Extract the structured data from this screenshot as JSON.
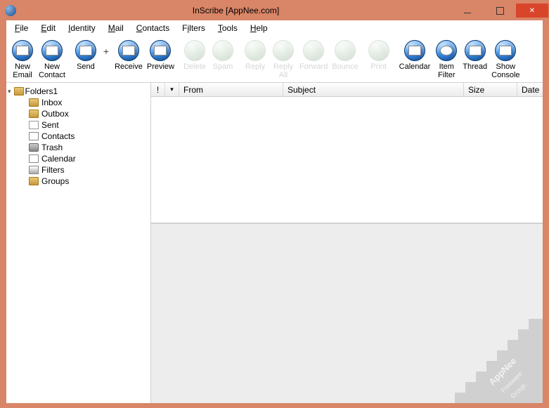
{
  "window": {
    "title": "InScribe [AppNee.com]"
  },
  "menu": {
    "file": "File",
    "edit": "Edit",
    "identity": "Identity",
    "mail": "Mail",
    "contacts": "Contacts",
    "filters": "Filters",
    "tools": "Tools",
    "help": "Help"
  },
  "toolbar": {
    "new_email": "New\nEmail",
    "new_contact": "New\nContact",
    "send": "Send",
    "plus": "+",
    "receive": "Receive",
    "preview": "Preview",
    "delete": "Delete",
    "spam": "Spam",
    "reply": "Reply",
    "reply_all": "Reply\nAll",
    "forward": "Forward",
    "bounce": "Bounce",
    "print": "Print",
    "calendar": "Calendar",
    "item_filter": "Item\nFilter",
    "thread": "Thread",
    "show_console": "Show\nConsole"
  },
  "sidebar": {
    "root": "Folders1",
    "items": [
      {
        "label": "Inbox"
      },
      {
        "label": "Outbox"
      },
      {
        "label": "Sent"
      },
      {
        "label": "Contacts"
      },
      {
        "label": "Trash"
      },
      {
        "label": "Calendar"
      },
      {
        "label": "Filters"
      },
      {
        "label": "Groups"
      }
    ]
  },
  "columns": {
    "flag1": "!",
    "flag2": "▼",
    "from": "From",
    "subject": "Subject",
    "size": "Size",
    "date": "Date"
  },
  "watermark": "AppNee Freeware Group."
}
